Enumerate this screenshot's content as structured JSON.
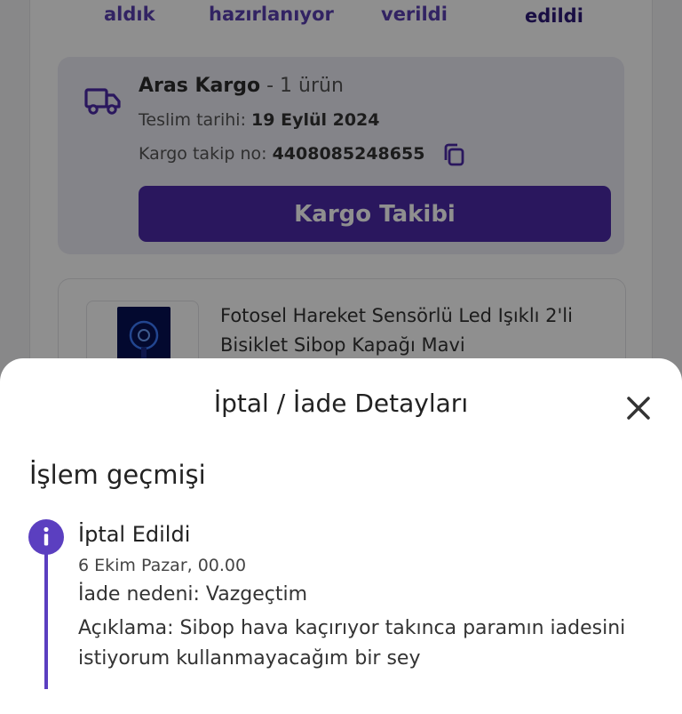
{
  "order_steps": [
    "aldık",
    "hazırlanıyor",
    "verildi",
    "edildi"
  ],
  "cargo": {
    "company": "Aras Kargo",
    "item_count": "- 1 ürün",
    "delivery_label": "Teslim tarihi:",
    "delivery_date": "19 Eylül 2024",
    "tracking_label": "Kargo takip no:",
    "tracking_number": "4408085248655",
    "track_button": "Kargo Takibi",
    "icon": "truck-icon",
    "copy_icon": "copy-icon"
  },
  "product": {
    "name": "Fotosel Hareket Sensörlü Led Işıklı 2'li Bisiklet Sibop Kapağı Mavi"
  },
  "sheet": {
    "title": "İptal / İade Detayları",
    "close_icon": "close-icon",
    "history_title": "İşlem geçmişi",
    "event": {
      "status": "İptal Edildi",
      "date": "6 Ekim Pazar, 00.00",
      "reason": "İade nedeni: Vazgeçtim",
      "description": "Açıklama: Sibop hava kaçırıyor takınca paramın iadesini istiyorum kullanmayacağım bir sey"
    }
  },
  "colors": {
    "accent": "#4b2aa8",
    "timeline": "#5b3fc0",
    "step_text": "#5a3fb0"
  }
}
